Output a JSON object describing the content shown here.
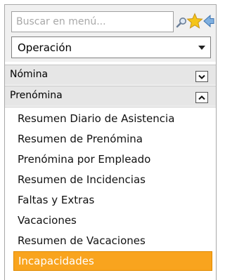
{
  "search": {
    "placeholder": "Buscar en menú..."
  },
  "module_select": {
    "selected": "Operación"
  },
  "sections": {
    "nomina": {
      "label": "Nómina",
      "expanded": false
    },
    "prenomina": {
      "label": "Prenómina",
      "expanded": true
    }
  },
  "menu": {
    "items": [
      "Resumen Diario de Asistencia",
      "Resumen de Prenómina",
      "Prenómina por Empleado",
      "Resumen de Incidencias",
      "Faltas y Extras",
      "Vacaciones",
      "Resumen de Vacaciones",
      "Incapacidades"
    ],
    "selected_index": 7
  },
  "colors": {
    "selected_bg": "#f9a41e",
    "header_bg": "#e6e6e6",
    "star": "#f5c518"
  },
  "icons": [
    "search-icon",
    "star-icon",
    "back-arrow-icon",
    "chevron-down-icon",
    "chevron-up-icon"
  ]
}
